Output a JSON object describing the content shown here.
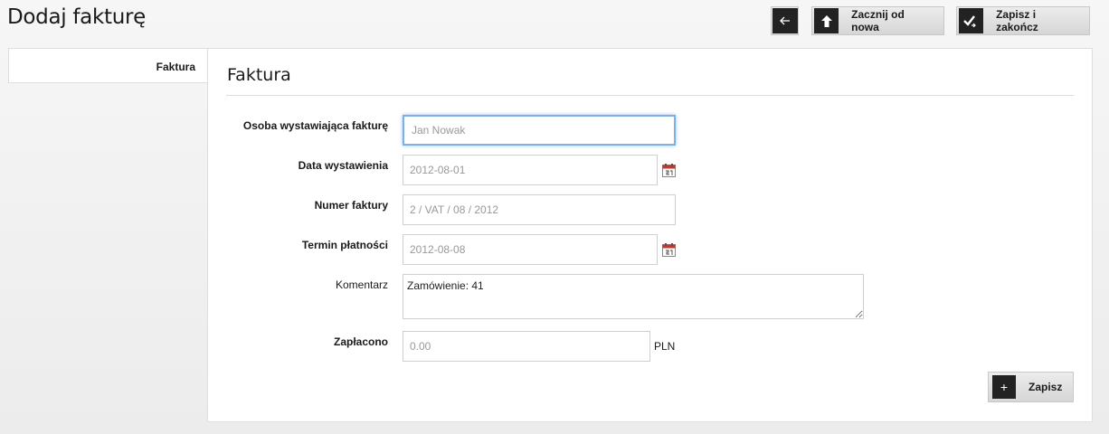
{
  "header": {
    "title": "Dodaj fakturę",
    "back_icon": "arrow-left-icon",
    "restart_label": "Zacznij od nowa",
    "restart_icon": "arrow-up-icon",
    "finish_label": "Zapisz i zakończ",
    "finish_icon": "double-check-icon"
  },
  "sidebar": {
    "tab_label": "Faktura"
  },
  "form": {
    "section_title": "Faktura",
    "fields": {
      "issuer": {
        "label": "Osoba wystawiająca fakturę",
        "value": "Jan Nowak"
      },
      "issue_date": {
        "label": "Data wystawienia",
        "value": "2012-08-01"
      },
      "number": {
        "label": "Numer faktury",
        "value": "2 / VAT / 08 / 2012"
      },
      "due_date": {
        "label": "Termin płatności",
        "value": "2012-08-08"
      },
      "comment": {
        "label": "Komentarz",
        "value": "Zamówienie: 41"
      },
      "paid": {
        "label": "Zapłacono",
        "value": "0.00",
        "unit": "PLN"
      }
    },
    "calendar_icon": "calendar-icon",
    "save_label": "Zapisz",
    "save_icon": "plus-icon"
  },
  "colors": {
    "focus_border": "#7fb0e4",
    "button_icon_bg": "#222222",
    "calendar_red": "#c0392b"
  }
}
